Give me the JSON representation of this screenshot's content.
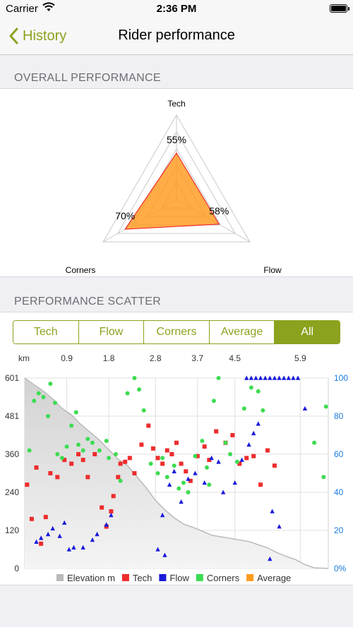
{
  "status": {
    "carrier": "Carrier",
    "time": "2:36 PM"
  },
  "nav": {
    "back_label": "History",
    "title": "Rider performance"
  },
  "overall": {
    "header": "OVERALL PERFORMANCE",
    "axes": [
      {
        "name": "Tech",
        "value": 55,
        "label": "55%"
      },
      {
        "name": "Flow",
        "value": 58,
        "label": "58%"
      },
      {
        "name": "Corners",
        "value": 70,
        "label": "70%"
      }
    ]
  },
  "scatter": {
    "header": "PERFORMANCE SCATTER",
    "tabs": [
      "Tech",
      "Flow",
      "Corners",
      "Average",
      "All"
    ],
    "active_tab": "All"
  },
  "colors": {
    "accent": "#8ba21e",
    "tech": "#ee2c2c",
    "flow": "#1a1adb",
    "corners": "#3cdc52",
    "average": "#ff9a1e",
    "elevation": "#b9b9b9"
  },
  "chart_data": [
    {
      "type": "radar",
      "categories": [
        "Tech",
        "Flow",
        "Corners"
      ],
      "values": [
        55,
        58,
        70
      ],
      "value_labels": [
        "55%",
        "58%",
        "70%"
      ],
      "series": [
        {
          "name": "Average",
          "values": [
            55,
            58,
            70
          ]
        }
      ],
      "range": [
        0,
        100
      ]
    },
    {
      "type": "scatter",
      "x_unit": "km",
      "xticks": [
        "0.9",
        "1.8",
        "2.8",
        "3.7",
        "4.5",
        "5.9"
      ],
      "xlim": [
        0,
        6.5
      ],
      "left_ylim": [
        0,
        601
      ],
      "left_yticks": [
        "0",
        "120",
        "240",
        "360",
        "481",
        "601"
      ],
      "right_ylim": [
        0,
        100
      ],
      "right_yticks": [
        "0%",
        "20",
        "40",
        "60",
        "80",
        "100"
      ],
      "legend": [
        "Elevation m",
        "Tech",
        "Flow",
        "Corners",
        "Average"
      ],
      "elevation": [
        [
          0,
          601
        ],
        [
          0.2,
          580
        ],
        [
          0.4,
          560
        ],
        [
          0.6,
          535
        ],
        [
          0.8,
          505
        ],
        [
          1.0,
          485
        ],
        [
          1.2,
          455
        ],
        [
          1.4,
          430
        ],
        [
          1.6,
          405
        ],
        [
          1.8,
          375
        ],
        [
          2.0,
          345
        ],
        [
          2.2,
          325
        ],
        [
          2.4,
          290
        ],
        [
          2.6,
          255
        ],
        [
          2.8,
          215
        ],
        [
          3.0,
          185
        ],
        [
          3.2,
          160
        ],
        [
          3.4,
          140
        ],
        [
          3.6,
          130
        ],
        [
          3.8,
          118
        ],
        [
          4.0,
          105
        ],
        [
          4.2,
          100
        ],
        [
          4.4,
          95
        ],
        [
          4.6,
          90
        ],
        [
          4.8,
          85
        ],
        [
          5.0,
          75
        ],
        [
          5.2,
          65
        ],
        [
          5.4,
          50
        ],
        [
          5.6,
          38
        ],
        [
          5.8,
          28
        ],
        [
          6.0,
          12
        ],
        [
          6.2,
          2
        ],
        [
          6.5,
          0
        ]
      ],
      "series": [
        {
          "name": "Tech",
          "marker": "square",
          "points": [
            [
              0.05,
              44
            ],
            [
              0.15,
              26
            ],
            [
              0.25,
              53
            ],
            [
              0.35,
              13
            ],
            [
              0.45,
              27
            ],
            [
              0.55,
              50
            ],
            [
              0.7,
              48
            ],
            [
              0.85,
              57
            ],
            [
              1.0,
              55
            ],
            [
              1.15,
              60
            ],
            [
              1.25,
              57
            ],
            [
              1.35,
              48
            ],
            [
              1.5,
              60
            ],
            [
              1.65,
              32
            ],
            [
              1.75,
              22
            ],
            [
              1.85,
              30
            ],
            [
              1.9,
              38
            ],
            [
              2.0,
              48
            ],
            [
              2.05,
              55
            ],
            [
              2.15,
              56
            ],
            [
              2.25,
              58
            ],
            [
              2.35,
              50
            ],
            [
              2.5,
              65
            ],
            [
              2.65,
              75
            ],
            [
              2.75,
              63
            ],
            [
              2.85,
              58
            ],
            [
              2.95,
              55
            ],
            [
              3.05,
              62
            ],
            [
              3.15,
              60
            ],
            [
              3.25,
              66
            ],
            [
              3.35,
              55
            ],
            [
              3.45,
              51
            ],
            [
              3.55,
              46
            ],
            [
              3.7,
              59
            ],
            [
              3.85,
              64
            ],
            [
              3.95,
              57
            ],
            [
              4.1,
              72
            ],
            [
              4.3,
              66
            ],
            [
              4.45,
              70
            ],
            [
              4.6,
              55
            ],
            [
              4.75,
              58
            ],
            [
              4.9,
              59
            ],
            [
              5.05,
              44
            ],
            [
              5.2,
              62
            ],
            [
              5.35,
              54
            ]
          ]
        },
        {
          "name": "Flow",
          "marker": "triangle",
          "points": [
            [
              0.25,
              14
            ],
            [
              0.35,
              16
            ],
            [
              0.5,
              18
            ],
            [
              0.6,
              21
            ],
            [
              0.75,
              17
            ],
            [
              0.85,
              24
            ],
            [
              0.95,
              10
            ],
            [
              1.05,
              11
            ],
            [
              1.25,
              11
            ],
            [
              1.45,
              15
            ],
            [
              1.55,
              18
            ],
            [
              1.75,
              23
            ],
            [
              1.85,
              28
            ],
            [
              2.95,
              28
            ],
            [
              3.1,
              44
            ],
            [
              3.2,
              51
            ],
            [
              3.35,
              35
            ],
            [
              3.5,
              47
            ],
            [
              3.65,
              50
            ],
            [
              3.85,
              45
            ],
            [
              4.0,
              58
            ],
            [
              4.15,
              56
            ],
            [
              4.25,
              40
            ],
            [
              4.5,
              45
            ],
            [
              4.75,
              100
            ],
            [
              4.85,
              100
            ],
            [
              4.95,
              100
            ],
            [
              5.05,
              100
            ],
            [
              5.15,
              100
            ],
            [
              5.25,
              100
            ],
            [
              5.35,
              100
            ],
            [
              5.45,
              100
            ],
            [
              5.55,
              100
            ],
            [
              5.65,
              100
            ],
            [
              5.75,
              100
            ],
            [
              5.85,
              100
            ],
            [
              5.3,
              30
            ],
            [
              5.45,
              22
            ],
            [
              4.65,
              57
            ],
            [
              4.8,
              65
            ],
            [
              4.9,
              71
            ],
            [
              5.0,
              76
            ],
            [
              6.0,
              84
            ],
            [
              2.85,
              10
            ],
            [
              3.0,
              7
            ],
            [
              5.25,
              5
            ]
          ]
        },
        {
          "name": "Corners",
          "marker": "circle",
          "points": [
            [
              0.1,
              62
            ],
            [
              0.2,
              88
            ],
            [
              0.3,
              92
            ],
            [
              0.4,
              90
            ],
            [
              0.5,
              80
            ],
            [
              0.55,
              97
            ],
            [
              0.65,
              87
            ],
            [
              0.7,
              60
            ],
            [
              0.8,
              58
            ],
            [
              0.9,
              64
            ],
            [
              1.0,
              75
            ],
            [
              1.1,
              82
            ],
            [
              1.15,
              65
            ],
            [
              1.25,
              62
            ],
            [
              1.35,
              68
            ],
            [
              1.45,
              66
            ],
            [
              1.6,
              62
            ],
            [
              1.75,
              67
            ],
            [
              1.8,
              58
            ],
            [
              1.95,
              60
            ],
            [
              2.05,
              46
            ],
            [
              2.2,
              92
            ],
            [
              2.35,
              100
            ],
            [
              2.45,
              94
            ],
            [
              2.55,
              83
            ],
            [
              2.7,
              55
            ],
            [
              2.85,
              50
            ],
            [
              2.95,
              58
            ],
            [
              3.05,
              48
            ],
            [
              3.2,
              54
            ],
            [
              3.3,
              42
            ],
            [
              3.4,
              45
            ],
            [
              3.5,
              40
            ],
            [
              3.65,
              59
            ],
            [
              3.8,
              67
            ],
            [
              3.9,
              53
            ],
            [
              3.95,
              44
            ],
            [
              4.05,
              88
            ],
            [
              4.15,
              100
            ],
            [
              4.3,
              66
            ],
            [
              4.4,
              60
            ],
            [
              4.55,
              56
            ],
            [
              4.7,
              84
            ],
            [
              4.85,
              95
            ],
            [
              5.0,
              93
            ],
            [
              5.1,
              83
            ],
            [
              6.2,
              66
            ],
            [
              6.4,
              48
            ],
            [
              6.45,
              85
            ]
          ]
        }
      ]
    }
  ]
}
